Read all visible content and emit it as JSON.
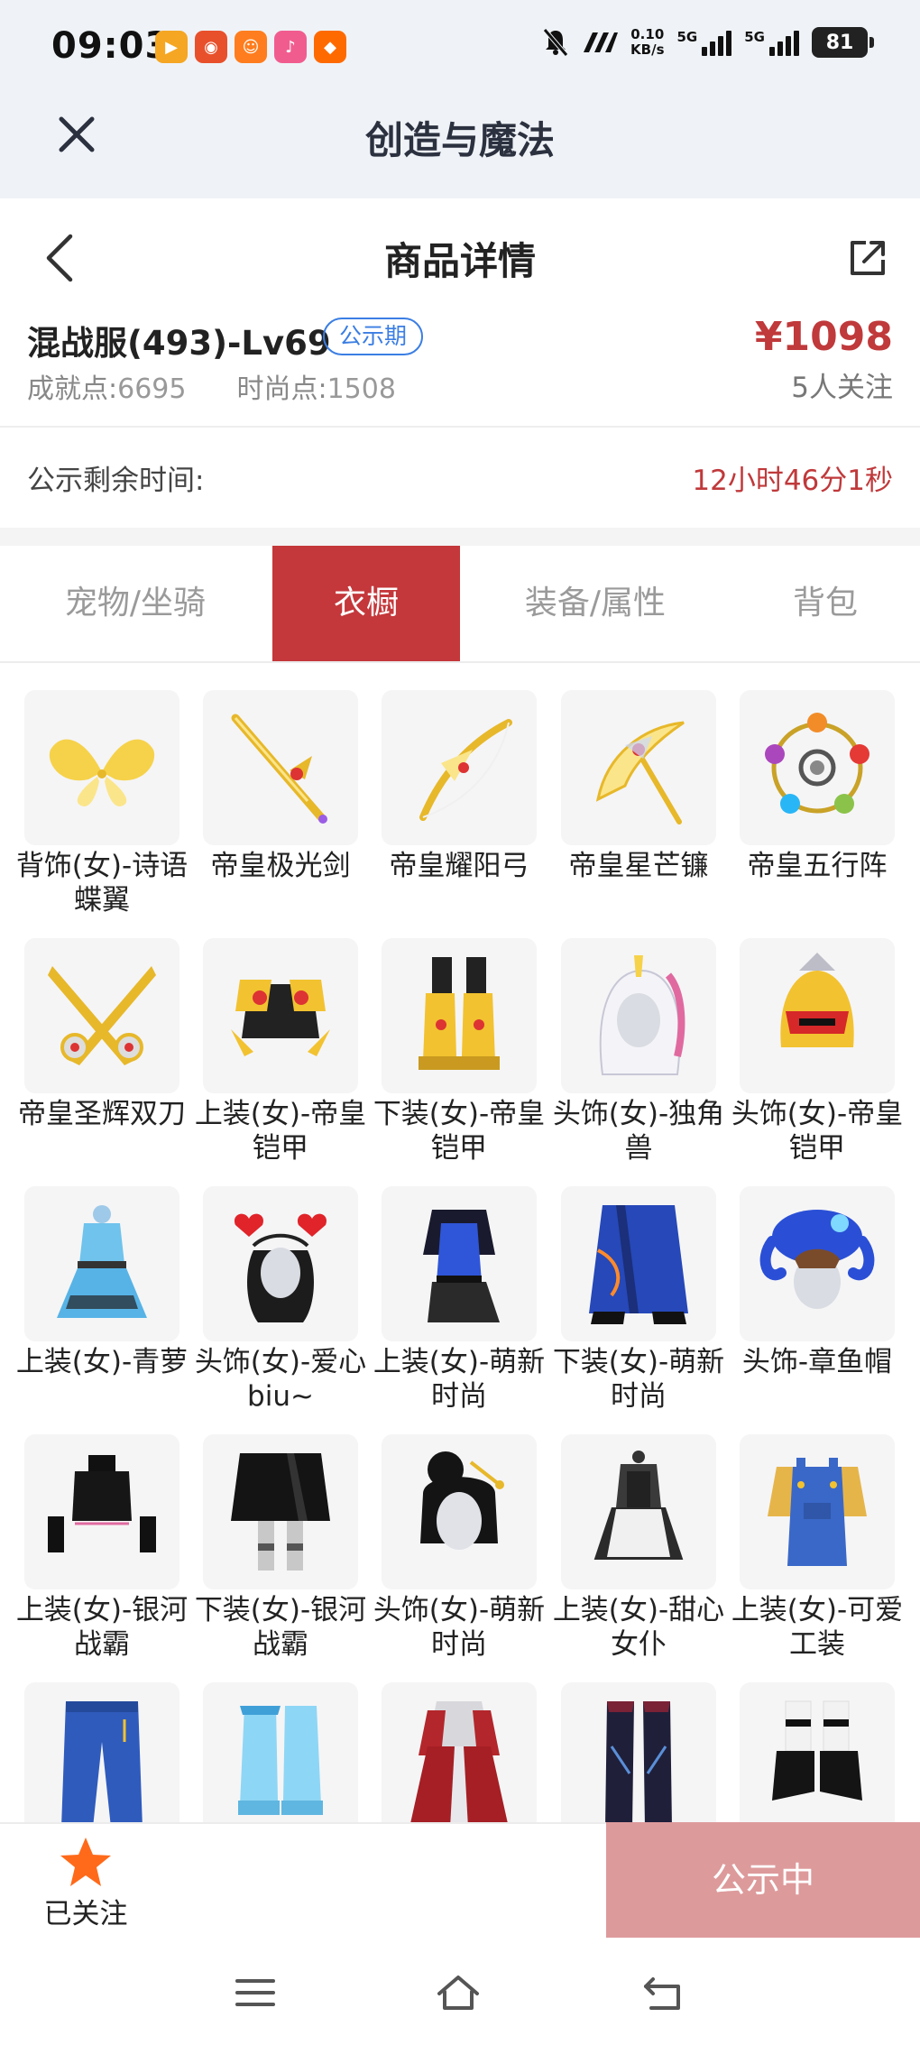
{
  "status_bar": {
    "time": "09:03",
    "net_speed_value": "0.10",
    "net_speed_unit": "KB/s",
    "sim1_label": "5G",
    "sim2_label": "5G",
    "battery": "81",
    "app_icons": [
      {
        "name": "video-app-icon",
        "color": "#f5a623"
      },
      {
        "name": "taobao-live-icon",
        "color": "#e8502c"
      },
      {
        "name": "fitness-app-icon",
        "color": "#ff7d1e"
      },
      {
        "name": "music-app-icon",
        "color": "#f15c8f"
      },
      {
        "name": "taobao-icon",
        "color": "#ff6a00"
      }
    ]
  },
  "app_header": {
    "title": "创造与魔法"
  },
  "page_header": {
    "title": "商品详情"
  },
  "product": {
    "name": "混战服(493)-Lv69",
    "badge": "公示期",
    "price": "¥1098",
    "achievement_label": "成就点:",
    "achievement_value": "6695",
    "fashion_label": "时尚点:",
    "fashion_value": "1508",
    "watchers": "5人关注"
  },
  "countdown": {
    "label": "公示剩余时间:",
    "value": "12小时46分1秒"
  },
  "tabs": [
    {
      "label": "宠物/坐骑",
      "active": false
    },
    {
      "label": "衣橱",
      "active": true
    },
    {
      "label": "装备/属性",
      "active": false
    },
    {
      "label": "背包",
      "active": false
    }
  ],
  "wardrobe_items": [
    {
      "name": "背饰(女)-诗语蝶翼",
      "icon": "butterfly-wings-icon"
    },
    {
      "name": "帝皇极光剑",
      "icon": "sword-icon"
    },
    {
      "name": "帝皇耀阳弓",
      "icon": "bow-icon"
    },
    {
      "name": "帝皇星芒镰",
      "icon": "scythe-icon"
    },
    {
      "name": "帝皇五行阵",
      "icon": "five-elements-ring-icon"
    },
    {
      "name": "帝皇圣辉双刀",
      "icon": "twin-blades-icon"
    },
    {
      "name": "上装(女)-帝皇铠甲",
      "icon": "armor-top-icon"
    },
    {
      "name": "下装(女)-帝皇铠甲",
      "icon": "armor-boots-icon"
    },
    {
      "name": "头饰(女)-独角兽",
      "icon": "unicorn-hood-icon"
    },
    {
      "name": "头饰(女)-帝皇铠甲",
      "icon": "armor-helmet-icon"
    },
    {
      "name": "上装(女)-青萝",
      "icon": "blue-dress-icon"
    },
    {
      "name": "头饰(女)-爱心biu~",
      "icon": "heart-headband-icon"
    },
    {
      "name": "上装(女)-萌新时尚",
      "icon": "blue-top-icon"
    },
    {
      "name": "下装(女)-萌新时尚",
      "icon": "blue-skirt-icon"
    },
    {
      "name": "头饰-章鱼帽",
      "icon": "octopus-hat-icon"
    },
    {
      "name": "上装(女)-银河战霸",
      "icon": "black-crop-top-icon"
    },
    {
      "name": "下装(女)-银河战霸",
      "icon": "black-skirt-icon"
    },
    {
      "name": "头饰(女)-萌新时尚",
      "icon": "bun-hair-icon"
    },
    {
      "name": "上装(女)-甜心女仆",
      "icon": "maid-dress-icon"
    },
    {
      "name": "上装(女)-可爱工装",
      "icon": "overalls-icon"
    },
    {
      "name": "",
      "icon": "jeans-icon"
    },
    {
      "name": "",
      "icon": "ice-boots-icon"
    },
    {
      "name": "",
      "icon": "red-robe-icon"
    },
    {
      "name": "",
      "icon": "dark-boots-icon"
    },
    {
      "name": "",
      "icon": "heels-icon"
    }
  ],
  "bottom_bar": {
    "follow_label": "已关注",
    "status_button": "公示中"
  },
  "colors": {
    "accent_red": "#c4373a",
    "price_red": "#c0393b",
    "badge_blue": "#3b7ee3",
    "disabled_button": "#dd9a9b",
    "star_orange": "#ff6a1a"
  }
}
